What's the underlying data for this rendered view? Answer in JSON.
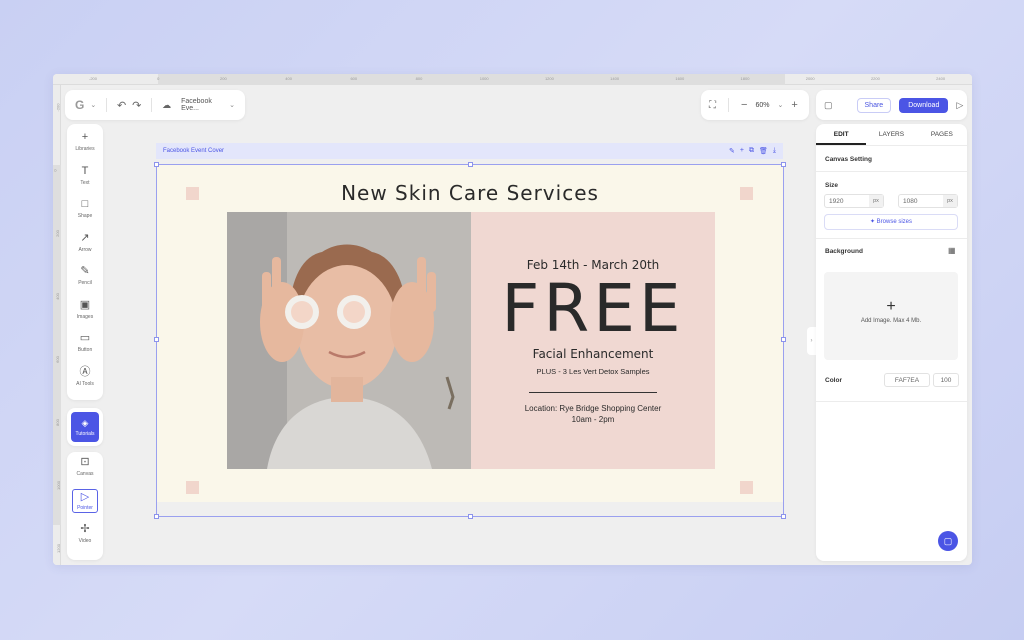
{
  "ruler": {
    "top_ticks": [
      "-200",
      "0",
      "200",
      "400",
      "600",
      "800",
      "1000",
      "1200",
      "1400",
      "1600",
      "1800",
      "2000",
      "2200",
      "2400"
    ],
    "left_ticks": [
      "-200",
      "0",
      "200",
      "400",
      "600",
      "800",
      "1000",
      "1200"
    ]
  },
  "topbar": {
    "logo": "G",
    "doc_name": "Facebook Eve...",
    "zoom": "60%",
    "share_label": "Share",
    "download_label": "Download"
  },
  "tools": [
    {
      "name": "libraries",
      "label": "Libraries",
      "icon": "+"
    },
    {
      "name": "text",
      "label": "Text",
      "icon": "T"
    },
    {
      "name": "shape",
      "label": "Shape",
      "icon": "□"
    },
    {
      "name": "arrow",
      "label": "Arrow",
      "icon": "↗"
    },
    {
      "name": "pencil",
      "label": "Pencil",
      "icon": "✎"
    },
    {
      "name": "images",
      "label": "Images",
      "icon": "▣"
    },
    {
      "name": "button",
      "label": "Button",
      "icon": "▭"
    },
    {
      "name": "ai-tools",
      "label": "AI Tools",
      "icon": "Ⓐ"
    }
  ],
  "tutorials_label": "Tutorials",
  "tools2": [
    {
      "name": "canvas",
      "label": "Canvas",
      "icon": "⊡"
    },
    {
      "name": "pointer",
      "label": "Pointer",
      "icon": "▷"
    },
    {
      "name": "video",
      "label": "Video",
      "icon": "✢"
    }
  ],
  "canvas": {
    "name": "Facebook Event Cover"
  },
  "design": {
    "headline": "New Skin Care Services",
    "date": "Feb 14th - March 20th",
    "free": "FREE",
    "subtitle": "Facial Enhancement",
    "plus": "PLUS - 3 Les Vert Detox Samples",
    "location": "Location: Rye Bridge Shopping Center",
    "hours": "10am - 2pm"
  },
  "right_panel": {
    "tabs": [
      "EDIT",
      "LAYERS",
      "PAGES"
    ],
    "canvas_setting": "Canvas Setting",
    "size_label": "Size",
    "width": "1920",
    "height": "1080",
    "unit": "px",
    "browse_sizes": "Browse sizes",
    "background_label": "Background",
    "add_image": "Add Image. Max 4 Mb.",
    "color_label": "Color",
    "color_hex": "FAF7EA",
    "opacity": "100"
  },
  "colors": {
    "accent": "#4B55E5",
    "design_bg": "#FAF7EA",
    "pink_panel": "#F0D8D2",
    "corner_square": "#F1D6CC"
  }
}
